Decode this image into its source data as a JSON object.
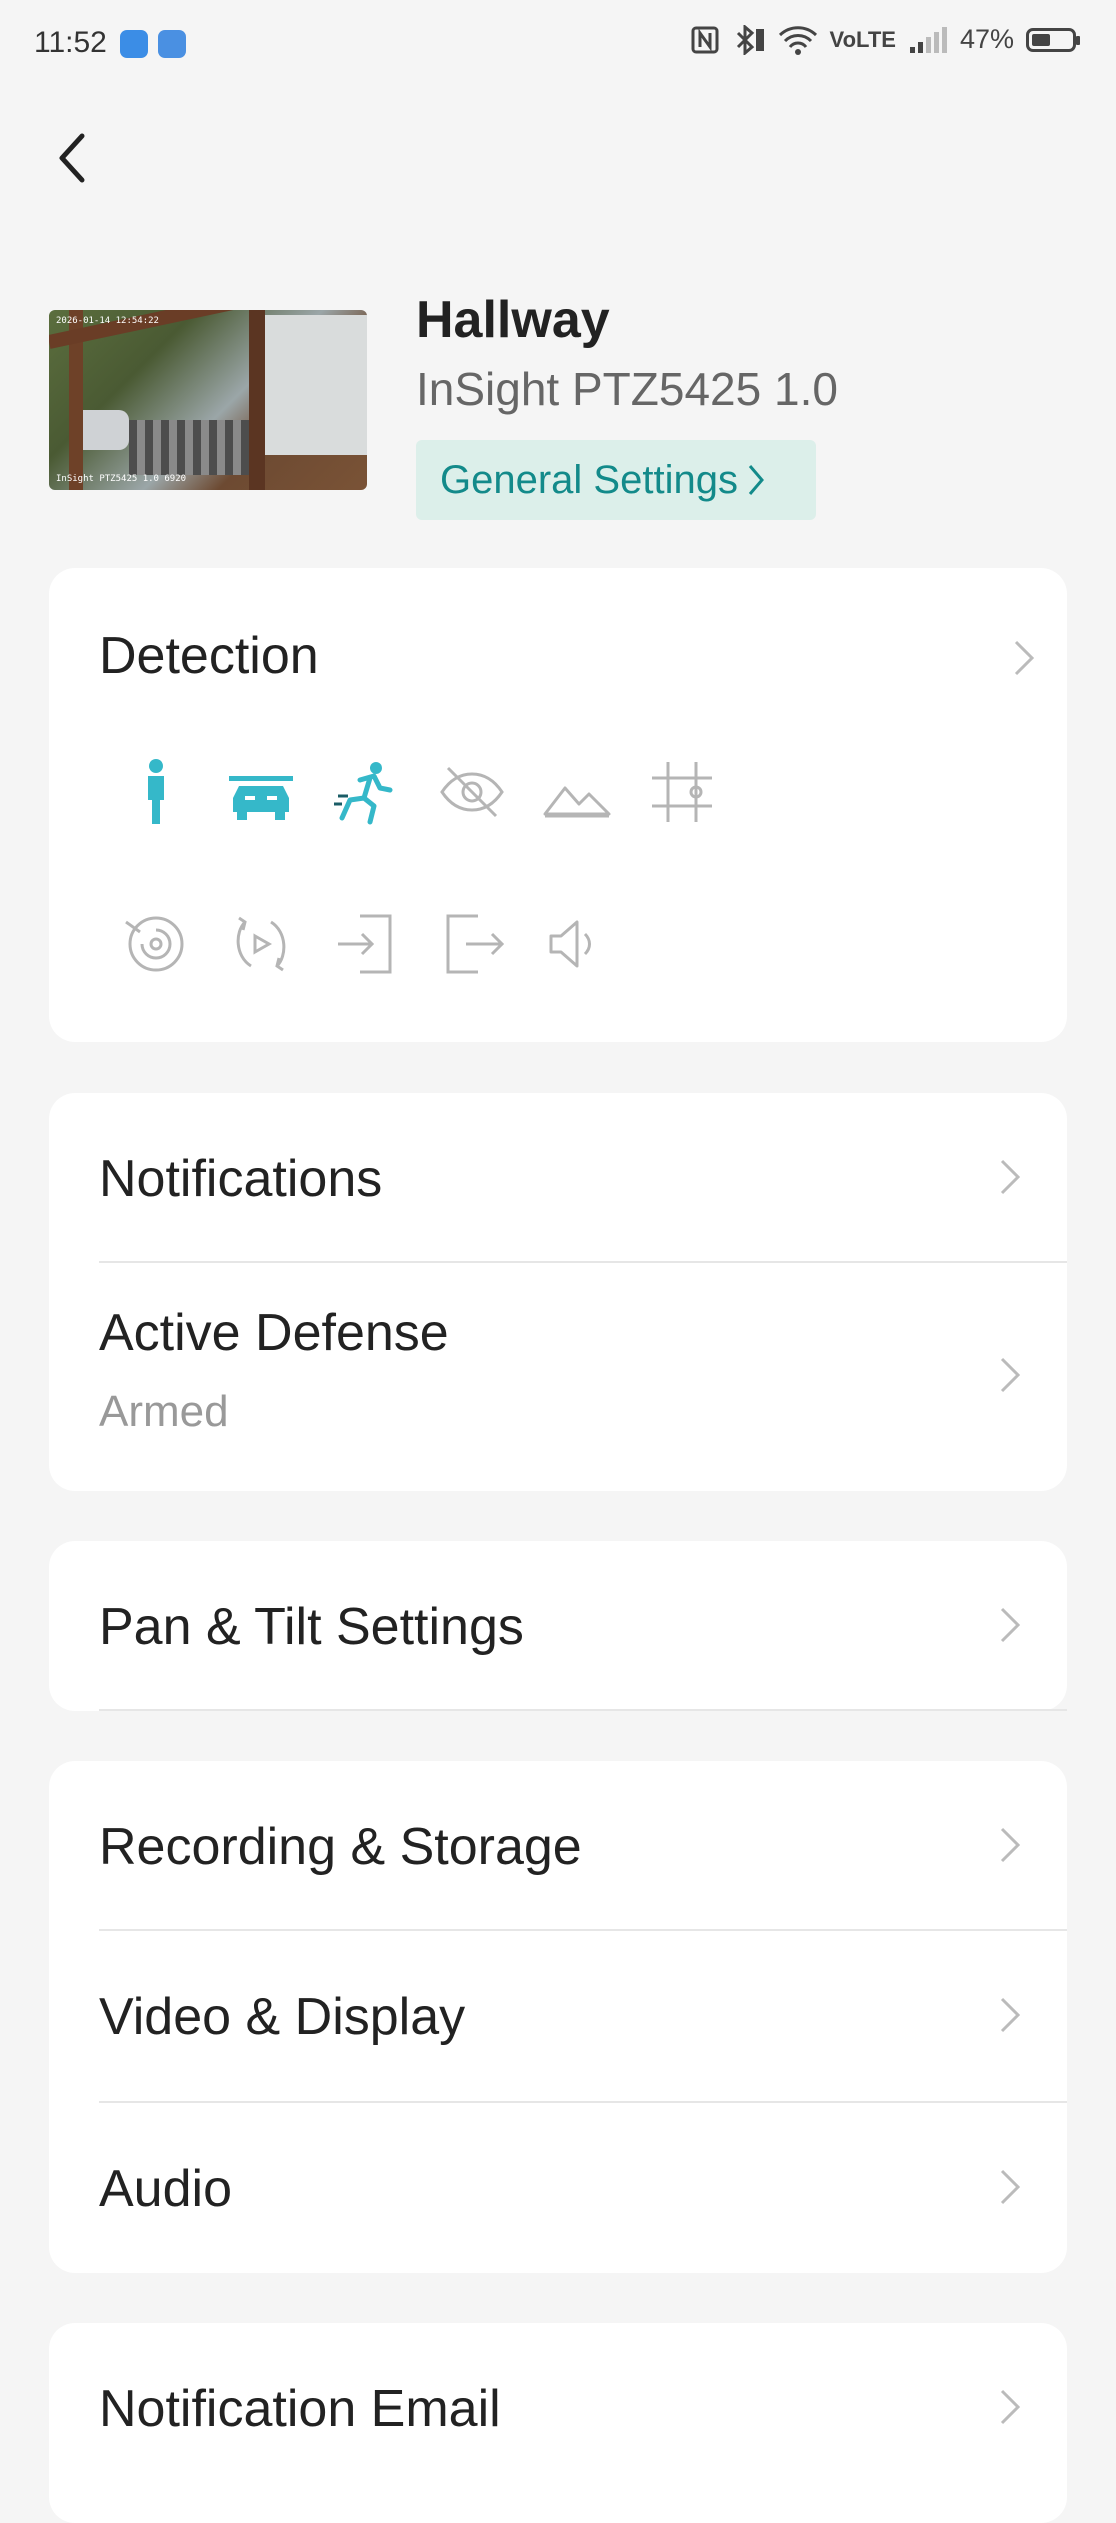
{
  "status_bar": {
    "time": "11:52",
    "network": "VoLTE",
    "battery": "47%"
  },
  "device": {
    "name": "Hallway",
    "model": "InSight PTZ5425 1.0",
    "thumbnail_timestamp": "2026-01-14 12:54:22",
    "thumbnail_camera": "InSight PTZ5425 1.0 6920",
    "general_settings_label": "General Settings"
  },
  "detection": {
    "title": "Detection",
    "icons": [
      {
        "name": "person-icon",
        "active": true
      },
      {
        "name": "vehicle-icon",
        "active": true
      },
      {
        "name": "motion-icon",
        "active": true
      },
      {
        "name": "camera-tampering-icon",
        "active": false
      },
      {
        "name": "scene-change-icon",
        "active": false
      },
      {
        "name": "line-crossing-icon",
        "active": false
      },
      {
        "name": "loitering-icon",
        "active": false
      },
      {
        "name": "object-removal-icon",
        "active": false
      },
      {
        "name": "area-entering-icon",
        "active": false
      },
      {
        "name": "area-exiting-icon",
        "active": false
      },
      {
        "name": "sound-detection-icon",
        "active": false
      }
    ],
    "active_color": "#35b8c9",
    "inactive_color": "#b5b5b5"
  },
  "menu": {
    "notifications": "Notifications",
    "active_defense": "Active Defense",
    "active_defense_status": "Armed",
    "pan_tilt": "Pan & Tilt Settings",
    "recording_storage": "Recording & Storage",
    "video_display": "Video & Display",
    "audio": "Audio",
    "notification_email": "Notification Email"
  },
  "colors": {
    "accent": "#138a8a",
    "accent_bg": "#dcefea",
    "background": "#f5f5f5"
  }
}
